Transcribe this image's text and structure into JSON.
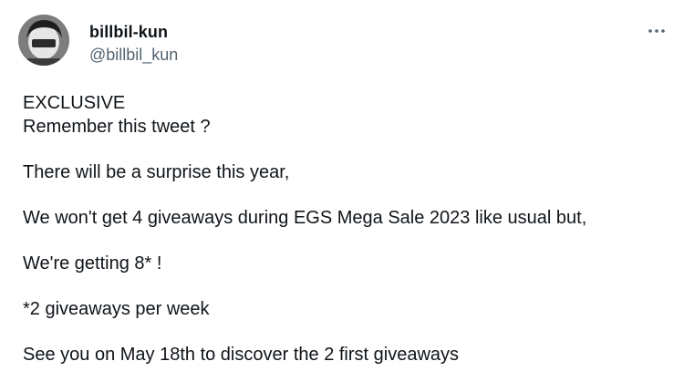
{
  "author": {
    "display_name": "billbil-kun",
    "handle": "@billbil_kun",
    "avatar_icon": "avatar-image"
  },
  "menu": {
    "icon": "more-horizontal-icon"
  },
  "tweet": {
    "lines": [
      "EXCLUSIVE",
      "Remember this tweet ?",
      "There will be a surprise this year,",
      "We won't get 4 giveaways during EGS Mega Sale 2023 like usual but,",
      "We're getting 8* !",
      "*2 giveaways per week",
      "See you on May 18th to discover the 2 first giveaways"
    ]
  }
}
